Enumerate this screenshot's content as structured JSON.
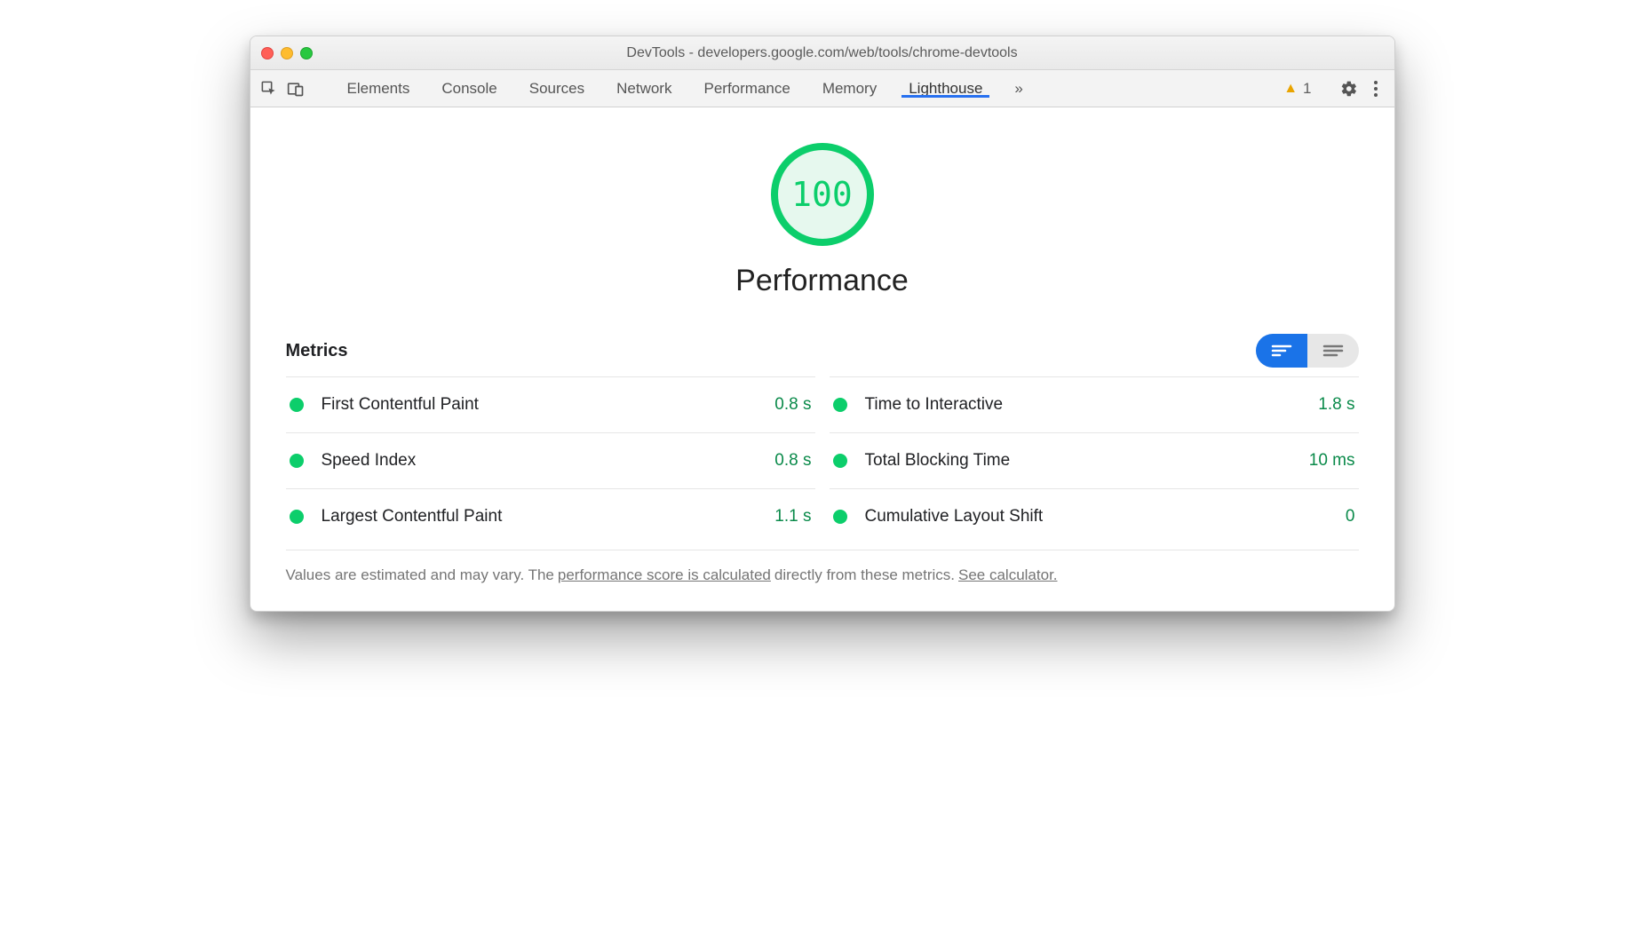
{
  "window": {
    "title": "DevTools - developers.google.com/web/tools/chrome-devtools"
  },
  "tabstrip": {
    "tabs": [
      "Elements",
      "Console",
      "Sources",
      "Network",
      "Performance",
      "Memory",
      "Lighthouse"
    ],
    "active_tab": "Lighthouse",
    "overflow_glyph": "»",
    "warning_count": "1"
  },
  "report": {
    "score": "100",
    "category": "Performance",
    "metrics_title": "Metrics",
    "metrics": [
      {
        "label": "First Contentful Paint",
        "value": "0.8 s"
      },
      {
        "label": "Time to Interactive",
        "value": "1.8 s"
      },
      {
        "label": "Speed Index",
        "value": "0.8 s"
      },
      {
        "label": "Total Blocking Time",
        "value": "10 ms"
      },
      {
        "label": "Largest Contentful Paint",
        "value": "1.1 s"
      },
      {
        "label": "Cumulative Layout Shift",
        "value": "0"
      }
    ],
    "footnote": {
      "part1": "Values are estimated and may vary. The ",
      "link1": "performance score is calculated",
      "part2": " directly from these metrics. ",
      "link2": "See calculator."
    }
  },
  "colors": {
    "good": "#0cce6b",
    "accent": "#1a73e8"
  }
}
